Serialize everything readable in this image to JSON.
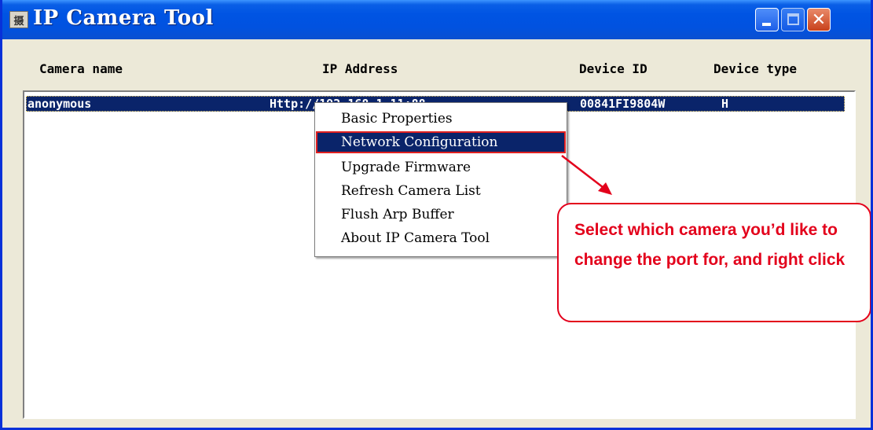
{
  "window": {
    "title": "IP Camera Tool",
    "app_icon_glyph": "摄",
    "controls": {
      "minimize": "minimize-icon",
      "maximize": "maximize-icon",
      "close": "close-icon"
    }
  },
  "columns": [
    "Camera name",
    "IP Address",
    "Device ID",
    "Device type"
  ],
  "rows": [
    {
      "camera_name": "anonymous",
      "ip_address": "Http://192.168.1.11:88",
      "device_id": "00841FI9804W",
      "device_type": "H",
      "selected": true
    }
  ],
  "context_menu": {
    "items": [
      {
        "label": "Basic Properties",
        "active": false
      },
      {
        "label": "Network Configuration",
        "active": true
      },
      {
        "label": "Upgrade Firmware",
        "active": false
      },
      {
        "label": "Refresh Camera List",
        "active": false
      },
      {
        "label": "Flush Arp Buffer",
        "active": false
      },
      {
        "label": "About IP Camera Tool",
        "active": false
      }
    ]
  },
  "annotation": {
    "text": "Select which camera you’d like to change the port for, and right click",
    "color": "#e3001b"
  },
  "colors": {
    "titlebar": "#0054e3",
    "selection": "#0a246a",
    "window_bg": "#ece9d8",
    "annotation": "#e3001b"
  }
}
